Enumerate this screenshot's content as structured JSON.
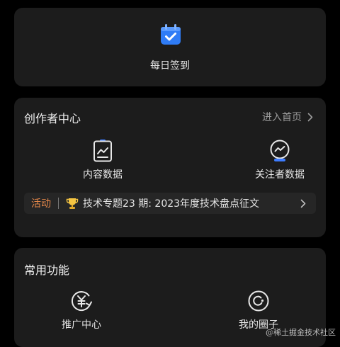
{
  "checkin": {
    "label": "每日签到",
    "icon": "calendar-check-icon"
  },
  "creator_center": {
    "title": "创作者中心",
    "homepage_link": "进入首页",
    "tiles": [
      {
        "label": "内容数据",
        "icon": "content-data-icon"
      },
      {
        "label": "关注者数据",
        "icon": "follower-data-icon"
      }
    ],
    "activity": {
      "tag": "活动",
      "text": "技术专题23 期:  2023年度技术盘点征文",
      "icon": "trophy-icon"
    }
  },
  "common_functions": {
    "title": "常用功能",
    "tiles": [
      {
        "label": "推广中心",
        "icon": "promotion-yuan-icon"
      },
      {
        "label": "我的圈子",
        "icon": "my-circle-icon"
      }
    ]
  },
  "watermark": "@稀土掘金技术社区",
  "colors": {
    "page_background": "#000000",
    "card_background": "#1c1c1c",
    "activity_accent": "#e8894a",
    "checkin_blue": "#2f7cf6"
  }
}
